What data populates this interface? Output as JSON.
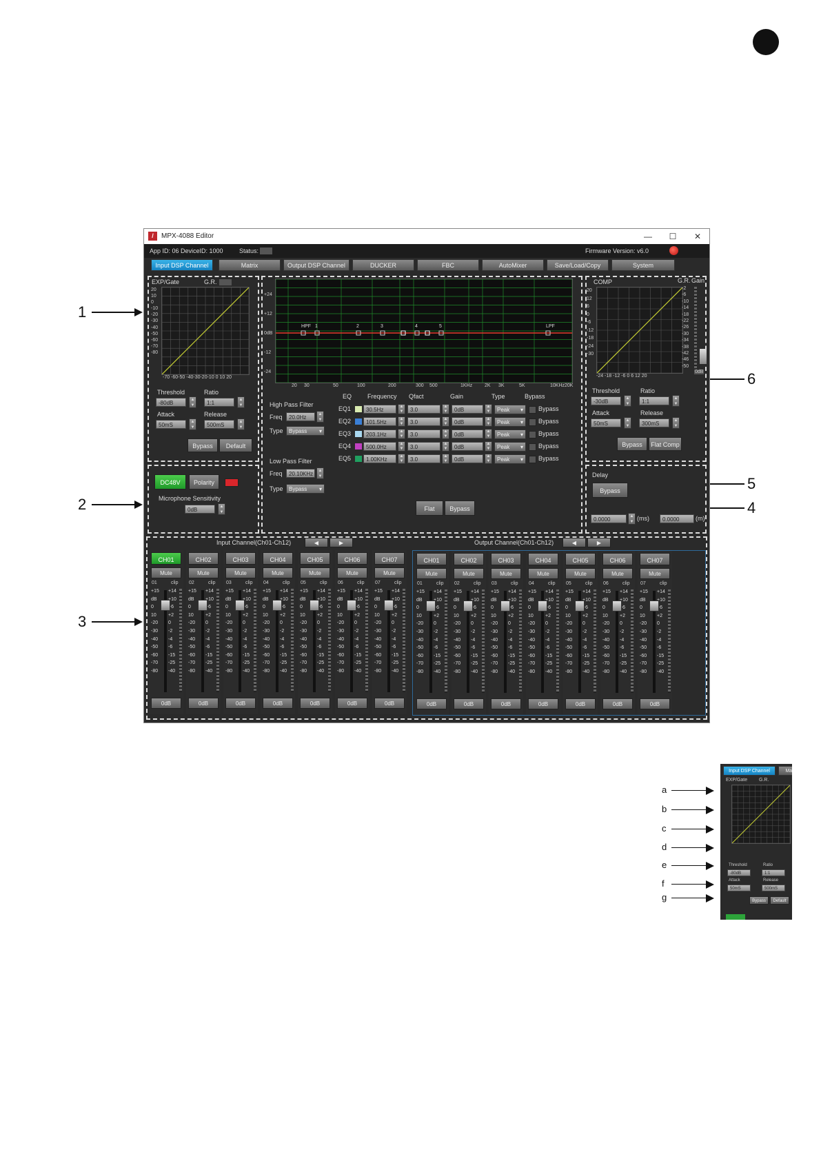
{
  "window": {
    "title": "MPX-4088 Editor",
    "min": "—",
    "max": "☐",
    "close": "✕",
    "app_id": "App ID: 06  DeviceID: 1000",
    "status_label": "Status:",
    "firmware": "Firmware Version: v6.0"
  },
  "tabs": [
    "Input DSP Channel",
    "Matrix",
    "Output DSP Channel",
    "DUCKER",
    "FBC",
    "AutoMixer",
    "Save/Load/Copy",
    "System"
  ],
  "exp_gate": {
    "title": "EXP/Gate",
    "gr_label": "G.R.",
    "y_ticks": [
      "20",
      "10",
      "0",
      "-10",
      "-20",
      "-30",
      "-40",
      "-50",
      "-60",
      "-70",
      "-80"
    ],
    "x_ticks": "-70 -60-50 -40-30-20-10  0 10 20",
    "threshold_label": "Threshold",
    "threshold_value": "-80dB",
    "ratio_label": "Ratio",
    "ratio_value": "1:1",
    "attack_label": "Attack",
    "attack_value": "50mS",
    "release_label": "Release",
    "release_value": "500mS",
    "bypass": "Bypass",
    "default": "Default"
  },
  "mic": {
    "dc48v": "DC48V",
    "polarity": "Polarity",
    "sensitivity_label": "Microphone Sensitivity",
    "sensitivity_value": "0dB"
  },
  "eq_graph": {
    "y_ticks": [
      "+24",
      "+12",
      "0dB",
      "-12",
      "-24"
    ],
    "x_ticks": [
      "20",
      "30",
      "50",
      "100",
      "200",
      "300",
      "500",
      "1KHz",
      "2K",
      "3K",
      "5K",
      "10KHz",
      "20K"
    ],
    "markers": [
      "HPF",
      "1",
      "2",
      "3",
      "4",
      "5",
      "LPF"
    ]
  },
  "hpf": {
    "title": "High Pass Filter",
    "freq_label": "Freq",
    "freq_value": "20.0Hz",
    "type_label": "Type",
    "type_value": "Bypass"
  },
  "lpf": {
    "title": "Low Pass Filter",
    "freq_label": "Freq",
    "freq_value": "20.10KHz",
    "type_label": "Type",
    "type_value": "Bypass"
  },
  "eq": {
    "headers": {
      "eq": "EQ",
      "frequency": "Frequency",
      "qfact": "Qfact",
      "gain": "Gain",
      "type": "Type",
      "bypass": "Bypass"
    },
    "rows": [
      {
        "name": "EQ1",
        "color": "#d9ebb0",
        "freq": "30.5Hz",
        "q": "3.0",
        "gain": "0dB",
        "type": "Peak",
        "bypass": "Bypass"
      },
      {
        "name": "EQ2",
        "color": "#3a7fd6",
        "freq": "101.5Hz",
        "q": "3.0",
        "gain": "0dB",
        "type": "Peak",
        "bypass": "Bypass"
      },
      {
        "name": "EQ3",
        "color": "#a9d8f0",
        "freq": "203.1Hz",
        "q": "3.0",
        "gain": "0dB",
        "type": "Peak",
        "bypass": "Bypass"
      },
      {
        "name": "EQ4",
        "color": "#c040c0",
        "freq": "500.0Hz",
        "q": "3.0",
        "gain": "0dB",
        "type": "Peak",
        "bypass": "Bypass"
      },
      {
        "name": "EQ5",
        "color": "#20a060",
        "freq": "1.00KHz",
        "q": "3.0",
        "gain": "0dB",
        "type": "Peak",
        "bypass": "Bypass"
      }
    ],
    "flat": "Flat",
    "bypass_btn": "Bypass"
  },
  "comp": {
    "title": "COMP",
    "gr_label": "G.R.",
    "gain_label": "Gain",
    "y_ticks": [
      "20",
      "12",
      "6",
      "0",
      "-6",
      "-12",
      "-18",
      "-24",
      "-30"
    ],
    "x_ticks": "-24  -18  -12   -6    0    6    12  20",
    "gr_scale": [
      "-2",
      "-6",
      "-10",
      "-14",
      "-18",
      "-22",
      "-26",
      "-30",
      "-34",
      "-38",
      "-42",
      "-46",
      "-50"
    ],
    "gain_value": "0dB",
    "threshold_label": "Threshold",
    "threshold_value": "-30dB",
    "ratio_label": "Ratio",
    "ratio_value": "1:1",
    "attack_label": "Attack",
    "attack_value": "50mS",
    "release_label": "Release",
    "release_value": "300mS",
    "bypass": "Bypass",
    "flat_comp": "Flat Comp"
  },
  "delay": {
    "title": "Delay",
    "bypass": "Bypass",
    "ms_value": "0.0000",
    "ms_unit": "(ms)",
    "m_value": "0.0000",
    "m_unit": "(m)"
  },
  "channels": {
    "input_title": "Input Channel(Ch01-Ch12)",
    "output_title": "Output Channel(Ch01-Ch12)",
    "prev": "◀",
    "next": "▶",
    "input": [
      {
        "label": "CH01",
        "num": "01"
      },
      {
        "label": "CH02",
        "num": "02"
      },
      {
        "label": "CH03",
        "num": "03"
      },
      {
        "label": "CH04",
        "num": "04"
      },
      {
        "label": "CH05",
        "num": "05"
      },
      {
        "label": "CH06",
        "num": "06"
      },
      {
        "label": "CH07",
        "num": "07"
      }
    ],
    "output": [
      {
        "label": "CH01",
        "num": "01"
      },
      {
        "label": "CH02",
        "num": "02"
      },
      {
        "label": "CH03",
        "num": "03"
      },
      {
        "label": "CH04",
        "num": "04"
      },
      {
        "label": "CH05",
        "num": "05"
      },
      {
        "label": "CH06",
        "num": "06"
      },
      {
        "label": "CH07",
        "num": "07"
      }
    ],
    "mute": "Mute",
    "zero": "0dB",
    "clip": "clip",
    "left_scale": [
      "+15",
      "dB",
      "0",
      "10",
      "-20",
      "-30",
      "-40",
      "-50",
      "-60",
      "-70",
      "-80"
    ],
    "right_scale": [
      "+14",
      "+10",
      "+6",
      "+2",
      "0",
      "-2",
      "-4",
      "-6",
      "-15",
      "-25",
      "-40"
    ]
  },
  "callouts": [
    "1",
    "2",
    "3",
    "4",
    "5",
    "6"
  ],
  "inset": {
    "letters": [
      "a",
      "b",
      "c",
      "d",
      "e",
      "f",
      "g"
    ],
    "tab": "Input DSP Channel",
    "tab2": "Matrix",
    "title": "EXP/Gate",
    "gr": "G.R.",
    "threshold": "Threshold",
    "ratio": "Ratio",
    "attack": "Attack",
    "release": "Release",
    "threshold_value": "-80dB",
    "ratio_value": "1:1",
    "attack_value": "50mS",
    "release_value": "500mS",
    "bypass": "Bypass",
    "default": "Default"
  }
}
